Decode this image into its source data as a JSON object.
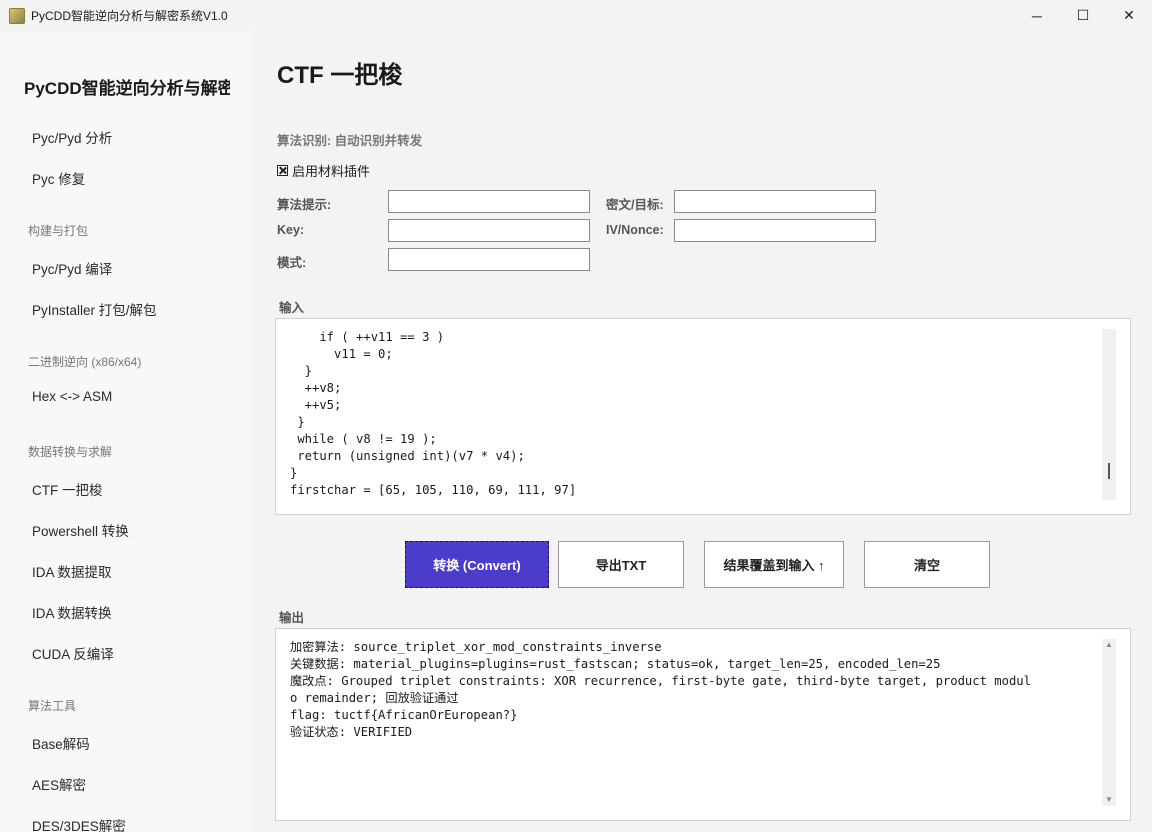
{
  "window": {
    "title": "PyCDD智能逆向分析与解密系统V1.0",
    "minimize": "─",
    "maximize": "☐",
    "close": "✕"
  },
  "sidebar": {
    "title": "PyCDD智能逆向分析与解密",
    "items": [
      {
        "type": "item",
        "label": "Pyc/Pyd 分析"
      },
      {
        "type": "item",
        "label": "Pyc 修复"
      },
      {
        "type": "section",
        "label": "构建与打包"
      },
      {
        "type": "item",
        "label": "Pyc/Pyd 编译"
      },
      {
        "type": "item",
        "label": "PyInstaller 打包/解包"
      },
      {
        "type": "section",
        "label": "二进制逆向 (x86/x64)"
      },
      {
        "type": "item",
        "label": "Hex <-> ASM"
      },
      {
        "type": "section",
        "label": "数据转换与求解"
      },
      {
        "type": "item",
        "label": "CTF 一把梭"
      },
      {
        "type": "item",
        "label": "Powershell 转换"
      },
      {
        "type": "item",
        "label": "IDA 数据提取"
      },
      {
        "type": "item",
        "label": "IDA 数据转换"
      },
      {
        "type": "item",
        "label": "CUDA 反编译"
      },
      {
        "type": "section",
        "label": "算法工具"
      },
      {
        "type": "item",
        "label": "Base解码"
      },
      {
        "type": "item",
        "label": "AES解密"
      },
      {
        "type": "item",
        "label": "DES/3DES解密"
      }
    ]
  },
  "main": {
    "title": "CTF 一把梭",
    "algo_id": "算法识别: 自动识别并转发",
    "plugin_checkbox": {
      "label": "启用材料插件",
      "checked": true
    },
    "fields": {
      "hint_label": "算法提示:",
      "hint_value": "",
      "cipher_label": "密文/目标:",
      "cipher_value": "",
      "key_label": "Key:",
      "key_value": "",
      "iv_label": "IV/Nonce:",
      "iv_value": "",
      "mode_label": "模式:",
      "mode_value": ""
    },
    "input_label": "输入",
    "input_code": "    if ( ++v11 == 3 )\n      v11 = 0;\n  }\n  ++v8;\n  ++v5;\n }\n while ( v8 != 19 );\n return (unsigned int)(v7 * v4);\n}\nfirstchar = [65, 105, 110, 69, 111, 97]",
    "buttons": {
      "convert": "转换 (Convert)",
      "export": "导出TXT",
      "overwrite": "结果覆盖到输入 ↑",
      "clear": "清空"
    },
    "output_label": "输出",
    "output_text": "加密算法: source_triplet_xor_mod_constraints_inverse\n关键数据: material_plugins=plugins=rust_fastscan; status=ok, target_len=25, encoded_len=25\n魔改点: Grouped triplet constraints: XOR recurrence, first-byte gate, third-byte target, product modul\no remainder; 回放验证通过\nflag: tuctf{AfricanOrEuropean?}\n验证状态: VERIFIED",
    "scroll_up": "▲",
    "scroll_down": "▼"
  }
}
